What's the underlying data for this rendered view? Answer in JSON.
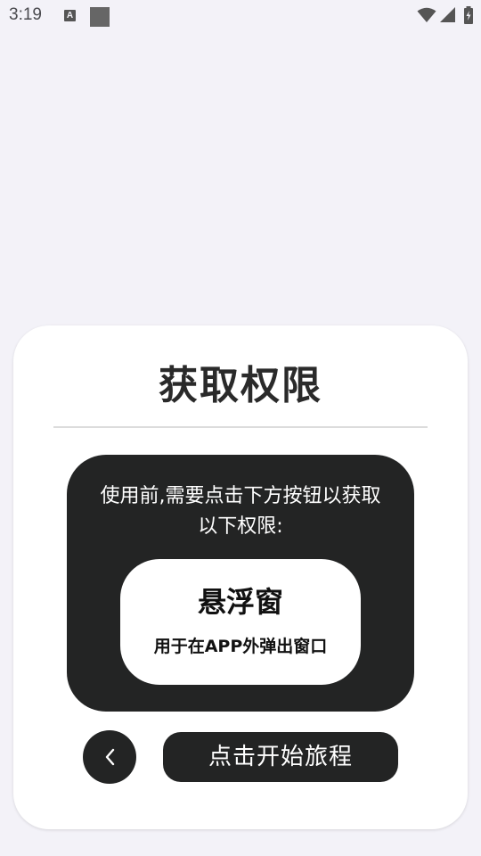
{
  "status_bar": {
    "time": "3:19",
    "a_icon_letter": "A",
    "icons": [
      "a-notification-icon",
      "square-notification-icon",
      "wifi-icon",
      "signal-icon",
      "battery-icon"
    ]
  },
  "dialog": {
    "title": "获取权限",
    "description": "使用前,需要点击下方按钮以获取以下权限:",
    "permission": {
      "name": "悬浮窗",
      "purpose": "用于在APP外弹出窗口"
    },
    "back_icon": "chevron-left-icon",
    "start_label": "点击开始旅程"
  },
  "colors": {
    "background": "#f3f2f8",
    "sheet": "#ffffff",
    "panel": "#232424",
    "title_text": "#2a2a2a"
  }
}
